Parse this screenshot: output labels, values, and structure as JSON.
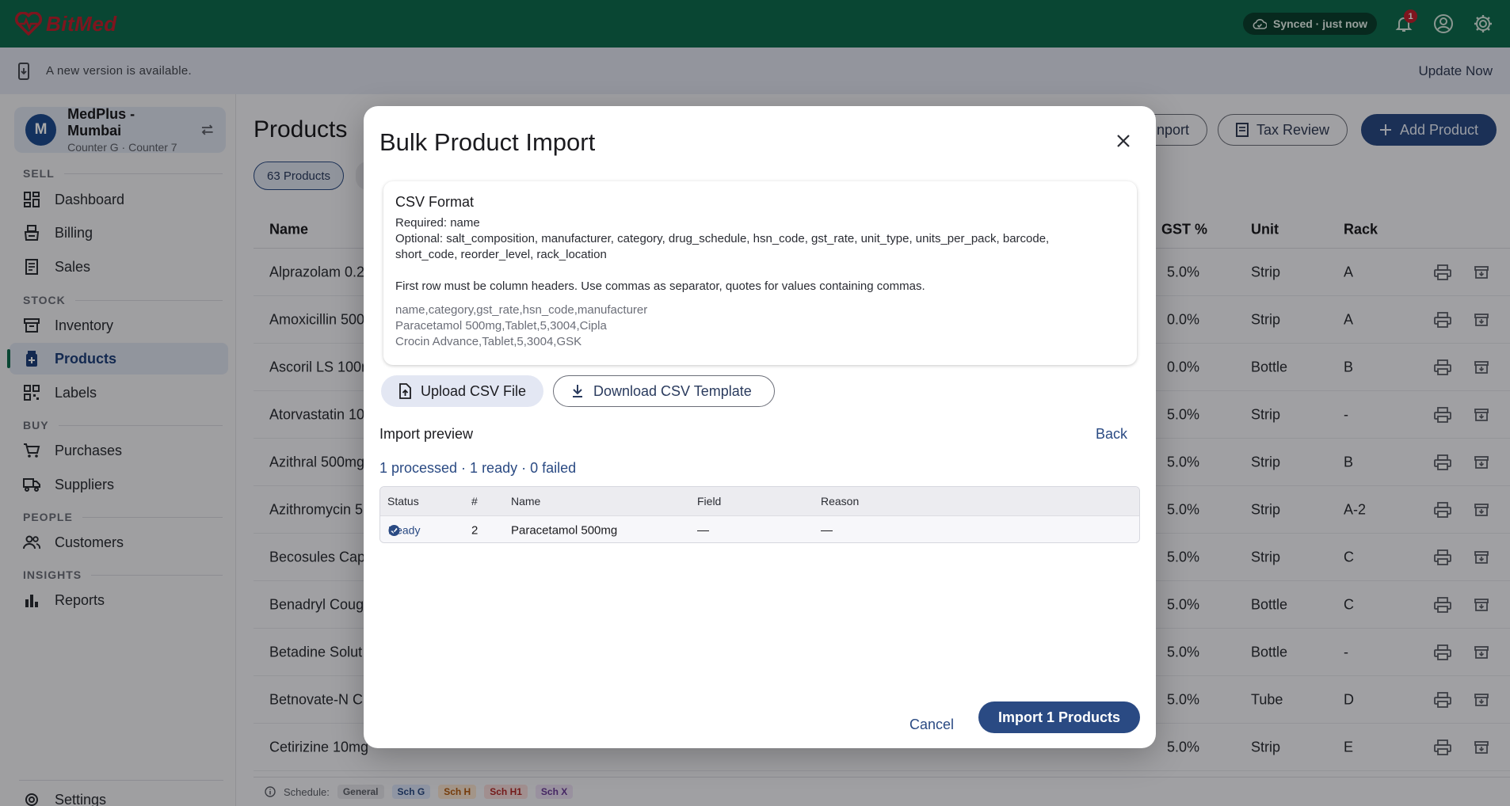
{
  "topbar": {
    "brand": "BitMed",
    "sync_status": "Synced · just now",
    "notifications_count": "1"
  },
  "banner": {
    "message": "A new version is available.",
    "action": "Update Now"
  },
  "store": {
    "initial": "M",
    "name": "MedPlus - Mumbai",
    "subtitle": "Counter G · Counter 7"
  },
  "sidebar": {
    "sections": {
      "sell": "SELL",
      "stock": "STOCK",
      "buy": "BUY",
      "people": "PEOPLE",
      "insights": "INSIGHTS"
    },
    "items": [
      {
        "label": "Dashboard",
        "icon": "dashboard-icon"
      },
      {
        "label": "Billing",
        "icon": "billing-icon"
      },
      {
        "label": "Sales",
        "icon": "sales-icon"
      },
      {
        "label": "Inventory",
        "icon": "inventory-icon"
      },
      {
        "label": "Products",
        "icon": "products-icon",
        "active": true
      },
      {
        "label": "Labels",
        "icon": "qr-icon"
      },
      {
        "label": "Purchases",
        "icon": "cart-icon"
      },
      {
        "label": "Suppliers",
        "icon": "truck-icon"
      },
      {
        "label": "Customers",
        "icon": "people-icon"
      },
      {
        "label": "Reports",
        "icon": "bar-chart-icon"
      },
      {
        "label": "Settings",
        "icon": "gear-icon"
      }
    ]
  },
  "products_page": {
    "title": "Products",
    "import_partial": "nport",
    "tax_review": "Tax Review",
    "add_product": "Add Product",
    "count_chip": "63 Products",
    "columns": {
      "name": "Name",
      "gst": "GST %",
      "unit": "Unit",
      "rack": "Rack"
    },
    "rows": [
      {
        "name": "Alprazolam 0.2",
        "gst": "5.0%",
        "unit": "Strip",
        "rack": "A"
      },
      {
        "name": "Amoxicillin 500",
        "gst": "0.0%",
        "unit": "Strip",
        "rack": "A"
      },
      {
        "name": "Ascoril LS 100n",
        "gst": "0.0%",
        "unit": "Bottle",
        "rack": "B"
      },
      {
        "name": "Atorvastatin 10",
        "gst": "5.0%",
        "unit": "Strip",
        "rack": "-"
      },
      {
        "name": "Azithral 500mg",
        "gst": "5.0%",
        "unit": "Strip",
        "rack": "B"
      },
      {
        "name": "Azithromycin 5",
        "gst": "5.0%",
        "unit": "Strip",
        "rack": "A-2"
      },
      {
        "name": "Becosules Cap",
        "gst": "5.0%",
        "unit": "Strip",
        "rack": "C"
      },
      {
        "name": "Benadryl Coug",
        "gst": "5.0%",
        "unit": "Bottle",
        "rack": "C"
      },
      {
        "name": "Betadine Solut",
        "gst": "5.0%",
        "unit": "Bottle",
        "rack": "-"
      },
      {
        "name": "Betnovate-N Cr",
        "gst": "5.0%",
        "unit": "Tube",
        "rack": "D"
      },
      {
        "name": "Cetirizine 10mg",
        "gst": "5.0%",
        "unit": "Strip",
        "rack": "E"
      }
    ],
    "legend": {
      "label": "Schedule:",
      "chips": [
        {
          "label": "General",
          "bg": "#e2e3e9",
          "fg": "#5c5f68"
        },
        {
          "label": "Sch G",
          "bg": "#d9e3f7",
          "fg": "#2a4a83"
        },
        {
          "label": "Sch H",
          "bg": "#f7e3cf",
          "fg": "#b25a12"
        },
        {
          "label": "Sch H1",
          "bg": "#f5d9d9",
          "fg": "#b02a2a"
        },
        {
          "label": "Sch X",
          "bg": "#e8dcf2",
          "fg": "#6a3a96"
        }
      ]
    }
  },
  "modal": {
    "title": "Bulk Product Import",
    "format": {
      "title": "CSV Format",
      "required": "Required: name",
      "optional_1": "Optional: salt_composition, manufacturer, category, drug_schedule, hsn_code, gst_rate, unit_type, units_per_pack, barcode,",
      "optional_2": "short_code, reorder_level, rack_location",
      "note": "First row must be column headers. Use commas as separator, quotes for values containing commas.",
      "example": [
        "name,category,gst_rate,hsn_code,manufacturer",
        "Paracetamol 500mg,Tablet,5,3004,Cipla",
        "Crocin Advance,Tablet,5,3004,GSK"
      ]
    },
    "upload_label": "Upload CSV File",
    "download_label": "Download CSV Template",
    "preview_title": "Import preview",
    "back_label": "Back",
    "summary": "1 processed · 1 ready · 0 failed",
    "preview_columns": {
      "status": "Status",
      "num": "#",
      "name": "Name",
      "field": "Field",
      "reason": "Reason"
    },
    "preview_rows": [
      {
        "status": "Ready",
        "num": "2",
        "name": "Paracetamol 500mg",
        "field": "—",
        "reason": "—"
      }
    ],
    "cancel_label": "Cancel",
    "import_label": "Import 1 Products"
  },
  "colors": {
    "brand_green": "#0e6b4e",
    "primary": "#2a4a83",
    "logo_red": "#c0202e"
  }
}
